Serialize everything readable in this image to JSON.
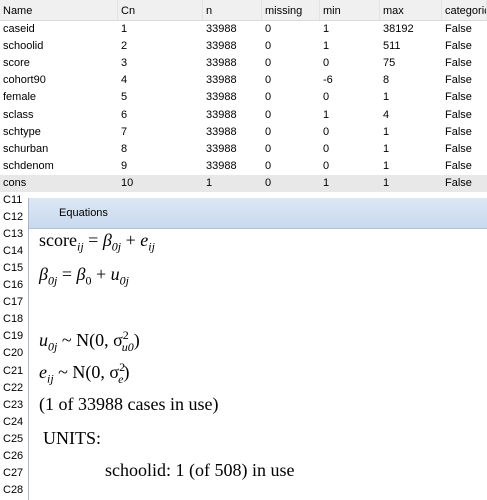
{
  "grid": {
    "columns": [
      "Name",
      "Cn",
      "n",
      "missing",
      "min",
      "max",
      "categoric"
    ],
    "rows": [
      {
        "name": "caseid",
        "cn": "1",
        "n": "33988",
        "missing": "0",
        "min": "1",
        "max": "38192",
        "categoric": "False"
      },
      {
        "name": "schoolid",
        "cn": "2",
        "n": "33988",
        "missing": "0",
        "min": "1",
        "max": "511",
        "categoric": "False"
      },
      {
        "name": "score",
        "cn": "3",
        "n": "33988",
        "missing": "0",
        "min": "0",
        "max": "75",
        "categoric": "False"
      },
      {
        "name": "cohort90",
        "cn": "4",
        "n": "33988",
        "missing": "0",
        "min": "-6",
        "max": "8",
        "categoric": "False"
      },
      {
        "name": "female",
        "cn": "5",
        "n": "33988",
        "missing": "0",
        "min": "0",
        "max": "1",
        "categoric": "False"
      },
      {
        "name": "sclass",
        "cn": "6",
        "n": "33988",
        "missing": "0",
        "min": "1",
        "max": "4",
        "categoric": "False"
      },
      {
        "name": "schtype",
        "cn": "7",
        "n": "33988",
        "missing": "0",
        "min": "0",
        "max": "1",
        "categoric": "False"
      },
      {
        "name": "schurban",
        "cn": "8",
        "n": "33988",
        "missing": "0",
        "min": "0",
        "max": "1",
        "categoric": "False"
      },
      {
        "name": "schdenom",
        "cn": "9",
        "n": "33988",
        "missing": "0",
        "min": "0",
        "max": "1",
        "categoric": "False"
      },
      {
        "name": "cons",
        "cn": "10",
        "n": "1",
        "missing": "0",
        "min": "1",
        "max": "1",
        "categoric": "False"
      }
    ],
    "extra_rows": [
      "C11",
      "C12",
      "C13",
      "C14",
      "C15",
      "C16",
      "C17",
      "C18",
      "C19",
      "C20",
      "C21",
      "C22",
      "C23",
      "C24",
      "C25",
      "C26",
      "C27",
      "C28"
    ]
  },
  "equations": {
    "title": "Equations",
    "eq1": {
      "lhs": "score",
      "lhs_sub": "ij",
      "eq": "=",
      "b": "β",
      "b_sub": "0j",
      "plus": "+",
      "e": "e",
      "e_sub": "ij"
    },
    "eq2": {
      "lhs": "β",
      "lhs_sub": "0j",
      "eq": "=",
      "b": "β",
      "b_sub": "0",
      "plus": "+",
      "u": "u",
      "u_sub": "0j"
    },
    "eq3": {
      "u": "u",
      "u_sub": "0j",
      "dist": "~ N(0, σ",
      "sigma_sub": "u0",
      "sigma_sup": "2",
      "close": ")"
    },
    "eq4": {
      "e": "e",
      "e_sub": "ij",
      "dist": "~ N(0, σ",
      "sigma_sub": "e",
      "sigma_sup": "2",
      "close": ")"
    },
    "cases": "(1 of 33988 cases in use)",
    "units_label": "UNITS:",
    "units_line": "schoolid: 1 (of 508) in use"
  }
}
